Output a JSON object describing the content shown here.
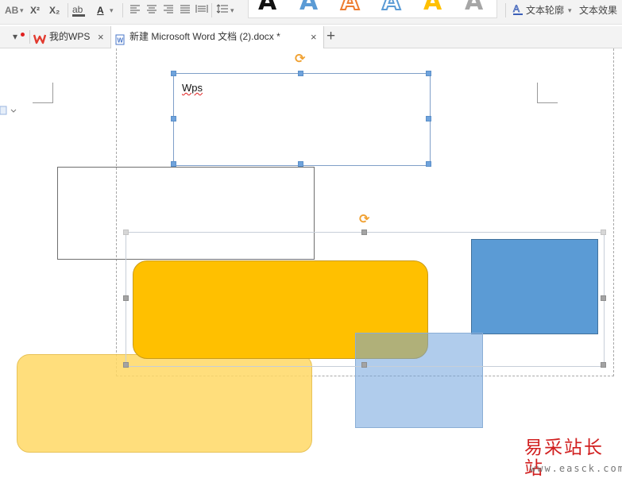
{
  "toolbar": {
    "ab_label": "AB",
    "superscript_label": "X²",
    "subscript_label": "X₂",
    "font_color_label": "A",
    "style_gallery": [
      "A",
      "A",
      "A",
      "A",
      "A",
      "A"
    ],
    "text_outline_label": "文本轮廓",
    "text_effect_label": "文本效果"
  },
  "tabs": [
    {
      "label": "我的WPS",
      "close": "×"
    },
    {
      "label": "新建 Microsoft Word 文档 (2).docx *",
      "close": "×"
    }
  ],
  "new_tab_label": "+",
  "document": {
    "textbox_text": "Wps"
  },
  "watermark": {
    "text": "易采站长站",
    "url": "www.easck.com"
  },
  "colors": {
    "orange_shape": "#ffc000",
    "light_orange_shape": "#ffd966",
    "blue_shape": "#5b9bd5",
    "light_blue_shape": "#9dc3e6",
    "selection_accent": "#6fa3dc"
  }
}
